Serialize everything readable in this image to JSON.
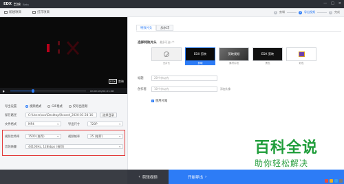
{
  "app": {
    "logo": "EDX",
    "name": "剪映",
    "beta": "Beta"
  },
  "window_controls": [
    "—",
    "□",
    "×"
  ],
  "toolbar": {
    "new_project": "新建项目",
    "open_project": "打开项目"
  },
  "steps": [
    {
      "num": "1",
      "label": "剪辑",
      "active": false
    },
    {
      "num": "2",
      "label": "导出视频",
      "active": true
    },
    {
      "num": "3",
      "label": "完成",
      "active": false
    }
  ],
  "preview": {
    "watermark_logo": "EDX",
    "watermark_name": "剪映",
    "time": "00:00:20/00:01:08",
    "progress_percent": 30
  },
  "export_settings": {
    "format_label": "导出设置",
    "options": [
      {
        "label": "视频格式",
        "selected": true
      },
      {
        "label": "GIF格式",
        "selected": false
      },
      {
        "label": "仅导出音频",
        "selected": false
      }
    ],
    "save_path_label": "保存路径",
    "save_path_value": "C:\\Users\\xxx\\Desktop\\Record_2020-01-28-16-...",
    "choose_dir_button": "选择目录",
    "file_format_label": "文件格式",
    "file_format_value": "MP4",
    "resolution_label": "导出尺寸",
    "resolution_value": "720P",
    "bitrate_label": "视频比特率",
    "bitrate_value": "1500 (推荐)",
    "framerate_label": "视频帧率",
    "framerate_value": "25 (推荐)",
    "audio_label": "音频质量",
    "audio_value": "44100Hz, 128kbps (推荐)"
  },
  "right_panel": {
    "tabs": [
      "特效片头",
      "加水印"
    ],
    "section_title": "选择特效片头",
    "section_hint": "最多可选1个",
    "thumbnails": [
      {
        "text": "",
        "caption": "无片头",
        "selected": false
      },
      {
        "text": "EDX 剪映",
        "caption": "剪映",
        "selected": true
      },
      {
        "text": "剪映视频",
        "caption": "素材片段",
        "selected": false
      },
      {
        "text": "EDX 剪映",
        "caption": "黑色",
        "selected": false
      },
      {
        "text": "",
        "caption": "彩色",
        "selected": false
      }
    ],
    "title_label": "标题",
    "title_placeholder": "20个字以内",
    "author_label": "创作者",
    "author_placeholder": "10个字以内",
    "author_extra": "添加头像",
    "checkbox_label": "使用片尾"
  },
  "bottom": {
    "edit_button": "剪辑视频",
    "export_button": "开始导出"
  },
  "overlay": {
    "brand_big": "百科全说",
    "brand_small": "助你轻松解决"
  }
}
